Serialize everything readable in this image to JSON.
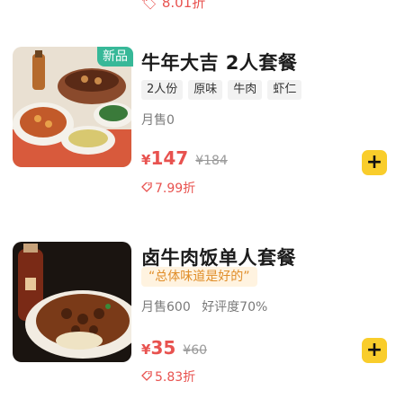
{
  "top_partial": {
    "discount": "8.01折"
  },
  "items": [
    {
      "badge": "新品",
      "name": "牛年大吉 2人套餐",
      "tags": [
        "2人份",
        "原味",
        "牛肉",
        "虾仁"
      ],
      "sales": "月售0",
      "currency": "¥",
      "price": "147",
      "original_price": "¥184",
      "discount": "7.99折",
      "add_button": "+",
      "icon": "tag-icon"
    },
    {
      "name": "卤牛肉饭单人套餐",
      "review_quote": "“总体味道是好的”",
      "sales": "月售600",
      "rating": "好评度70%",
      "currency": "¥",
      "price": "35",
      "original_price": "¥60",
      "discount": "5.83折",
      "add_button": "+",
      "icon": "tag-icon"
    }
  ],
  "colors": {
    "price_red": "#e8524f",
    "badge_green": "#37b898",
    "add_yellow": "#f9cd2b",
    "quote_orange": "#e08e2a"
  }
}
